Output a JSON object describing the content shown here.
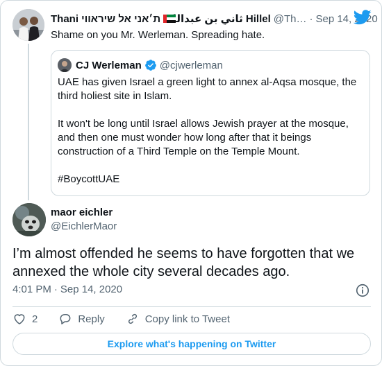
{
  "parent_tweet": {
    "name": "Thani ת׳אני אל שיראווי",
    "name_rtl": "ثاني بن عبدالله Hillel",
    "handle": "@Th…",
    "separator": "·",
    "date": "Sep 14, 2020",
    "text": "Shame on you Mr. Werleman. Spreading hate."
  },
  "quoted_tweet": {
    "name": "CJ Werleman",
    "handle": "@cjwerleman",
    "paragraphs": [
      "UAE has given Israel a green light to annex al-Aqsa mosque, the third holiest site in Islam.",
      "It won't be long until Israel allows Jewish prayer at the mosque, and then one must wonder how long after that it beings construction of a Third Temple on the Temple Mount.",
      "#BoycottUAE"
    ]
  },
  "main_tweet": {
    "name": "maor eichler",
    "handle": "@EichlerMaor",
    "text": "I’m almost offended he seems to have forgotten that we annexed the whole city several decades ago.",
    "time": "4:01 PM",
    "separator": "·",
    "date": "Sep 14, 2020"
  },
  "actions": {
    "like_count": "2",
    "reply_label": "Reply",
    "copy_label": "Copy link to Tweet"
  },
  "explore_label": "Explore what's happening on Twitter",
  "icons": {
    "twitter": "twitter-bird-icon",
    "verified": "verified-badge-icon",
    "info": "info-icon",
    "like": "heart-icon",
    "reply": "reply-bubble-icon",
    "copy_link": "link-icon"
  },
  "colors": {
    "accent": "#1d9bf0",
    "text_primary": "#0f1419",
    "text_secondary": "#536471",
    "border": "#cfd9de"
  }
}
